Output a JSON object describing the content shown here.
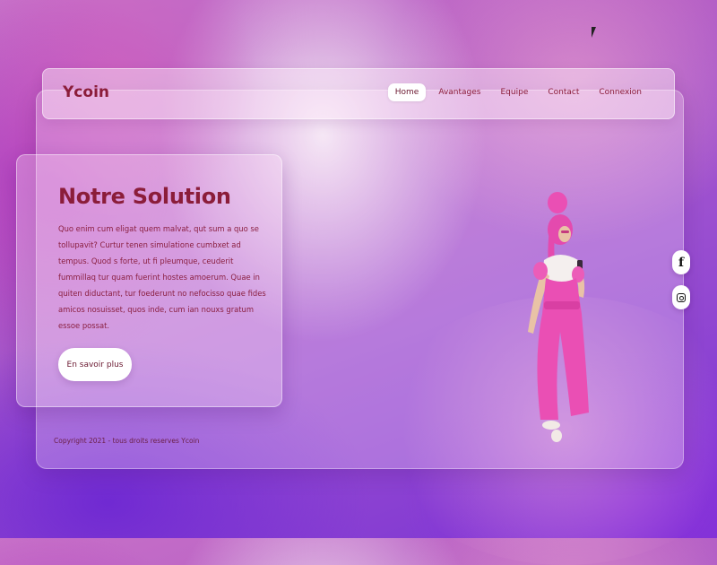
{
  "brand": {
    "logo": "Ycoin"
  },
  "nav": {
    "items": [
      {
        "label": "Home",
        "active": true
      },
      {
        "label": "Avantages",
        "active": false
      },
      {
        "label": "Equipe",
        "active": false
      },
      {
        "label": "Contact",
        "active": false
      },
      {
        "label": "Connexion",
        "active": false
      }
    ]
  },
  "hero": {
    "title": "Notre Solution",
    "paragraph": "Quo enim cum eligat quem malvat, qut sum a quo se tollupavit? Curtur tenen simulatione cumbxet ad tempus. Quod s forte, ut fi pleumque, ceuderit fummillaq tur quam fuerint hostes amoerum. Quae in quiten diductant, tur foederunt no nefocisso quae fides amicos nosuisset, quos inde, cum ian nouxs gratum essoe possat.",
    "cta_label": "En savoir plus"
  },
  "footer": {
    "copyright": "Copyright 2021 - tous droits reserves Ycoin"
  },
  "social": {
    "facebook_glyph": "f"
  },
  "colors": {
    "brand_text": "#8b1d3a",
    "figure_pink": "#ea4fb4",
    "background_purple": "#7a32d4"
  }
}
